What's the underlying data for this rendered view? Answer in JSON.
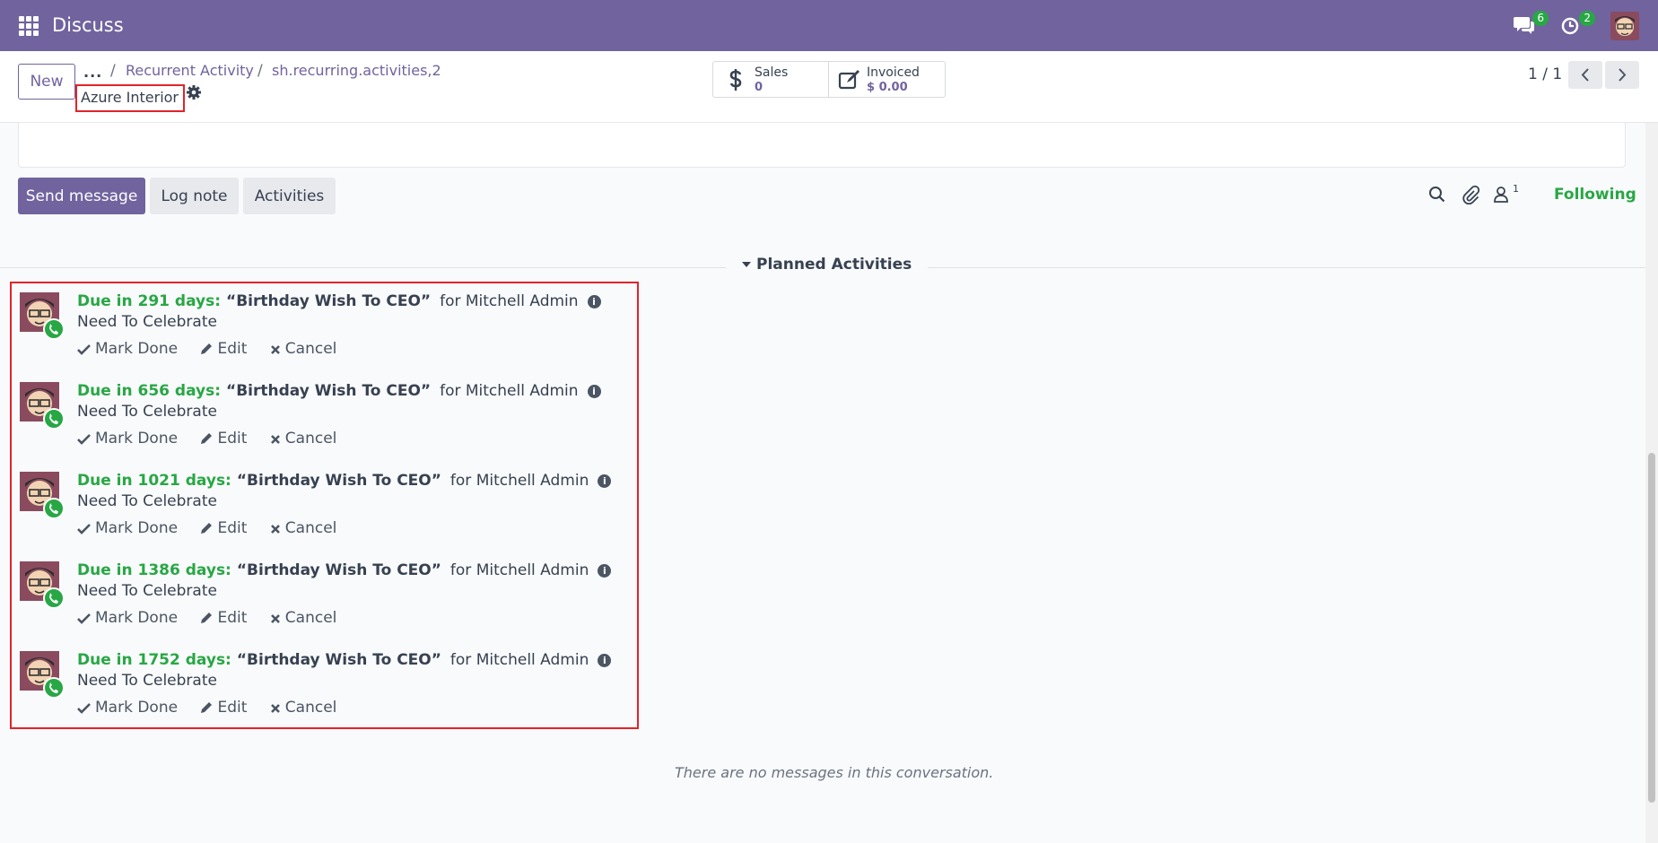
{
  "navbar": {
    "app_title": "Discuss",
    "messages_badge": "6",
    "activities_badge": "2",
    "brand_color": "#71639e"
  },
  "control_panel": {
    "new_label": "New",
    "breadcrumb": {
      "more": "...",
      "items": [
        "Recurrent Activity",
        "sh.recurring.activities,2"
      ]
    },
    "record_name": "Azure Interior",
    "smart_buttons": [
      {
        "label": "Sales",
        "value": "0",
        "icon": "dollar-icon"
      },
      {
        "label": "Invoiced",
        "value": "$ 0.00",
        "icon": "edit-icon"
      }
    ],
    "pager": "1 / 1"
  },
  "chatter": {
    "send_message": "Send message",
    "log_note": "Log note",
    "activities": "Activities",
    "followers_count": "1",
    "following": "Following",
    "planned_header": "Planned Activities",
    "activity_list": [
      {
        "due": "Due in 291 days:",
        "title": "“Birthday Wish To CEO”",
        "assignee": "for Mitchell Admin",
        "note": "Need To Celebrate"
      },
      {
        "due": "Due in 656 days:",
        "title": "“Birthday Wish To CEO”",
        "assignee": "for Mitchell Admin",
        "note": "Need To Celebrate"
      },
      {
        "due": "Due in 1021 days:",
        "title": "“Birthday Wish To CEO”",
        "assignee": "for Mitchell Admin",
        "note": "Need To Celebrate"
      },
      {
        "due": "Due in 1386 days:",
        "title": "“Birthday Wish To CEO”",
        "assignee": "for Mitchell Admin",
        "note": "Need To Celebrate"
      },
      {
        "due": "Due in 1752 days:",
        "title": "“Birthday Wish To CEO”",
        "assignee": "for Mitchell Admin",
        "note": "Need To Celebrate"
      }
    ],
    "actions": {
      "mark_done": "Mark Done",
      "edit": "Edit",
      "cancel": "Cancel"
    },
    "empty_message": "There are no messages in this conversation."
  }
}
